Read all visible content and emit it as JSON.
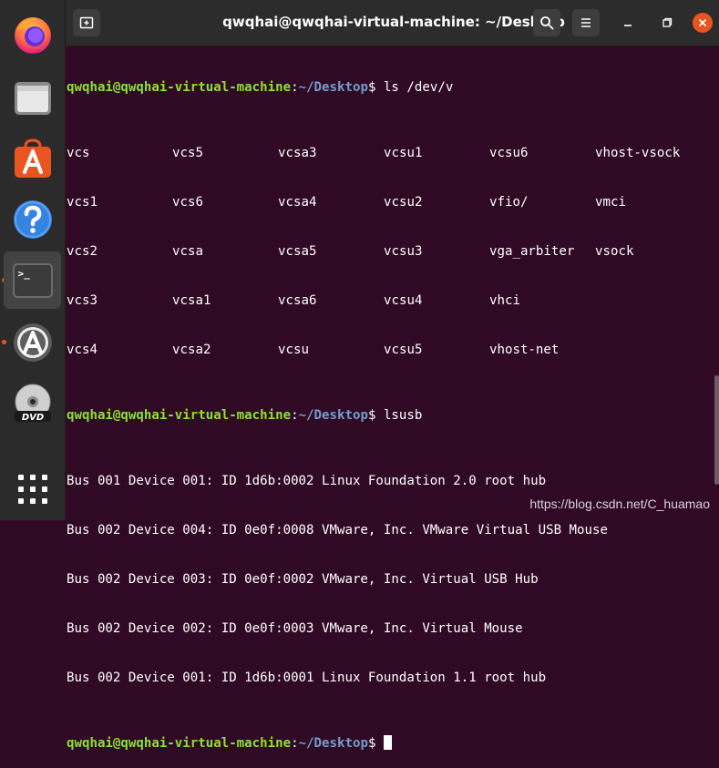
{
  "window": {
    "title": "qwqhai@qwqhai-virtual-machine: ~/Desktop"
  },
  "dock": {
    "items": [
      {
        "name": "firefox-icon"
      },
      {
        "name": "files-icon"
      },
      {
        "name": "software-center-icon"
      },
      {
        "name": "help-icon"
      },
      {
        "name": "terminal-icon"
      },
      {
        "name": "software-updater-icon"
      },
      {
        "name": "dvd-icon"
      },
      {
        "name": "show-applications-icon"
      }
    ],
    "terminal_badge": ">_"
  },
  "terminal": {
    "prompt_user": "qwqhai@qwqhai-virtual-machine",
    "prompt_sep": ":",
    "prompt_path": "~/Desktop",
    "prompt_end": "$ ",
    "cmd1": "ls /dev/v",
    "ls_rows": [
      [
        "vcs",
        "vcs5",
        "vcsa3",
        "vcsu1",
        "vcsu6",
        "vhost-vsock"
      ],
      [
        "vcs1",
        "vcs6",
        "vcsa4",
        "vcsu2",
        "vfio/",
        "vmci"
      ],
      [
        "vcs2",
        "vcsa",
        "vcsa5",
        "vcsu3",
        "vga_arbiter",
        "vsock"
      ],
      [
        "vcs3",
        "vcsa1",
        "vcsa6",
        "vcsu4",
        "vhci",
        ""
      ],
      [
        "vcs4",
        "vcsa2",
        "vcsu",
        "vcsu5",
        "vhost-net",
        ""
      ]
    ],
    "cmd2": "lsusb",
    "lsusb_lines": [
      "Bus 001 Device 001: ID 1d6b:0002 Linux Foundation 2.0 root hub",
      "Bus 002 Device 004: ID 0e0f:0008 VMware, Inc. VMware Virtual USB Mouse",
      "Bus 002 Device 003: ID 0e0f:0002 VMware, Inc. Virtual USB Hub",
      "Bus 002 Device 002: ID 0e0f:0003 VMware, Inc. Virtual Mouse",
      "Bus 002 Device 001: ID 1d6b:0001 Linux Foundation 1.1 root hub"
    ]
  },
  "watermark": "https://blog.csdn.net/C_huamao",
  "colors": {
    "terminal_bg": "#300a24",
    "prompt_user": "#8ae234",
    "prompt_path": "#729fcf",
    "accent": "#e95420"
  }
}
